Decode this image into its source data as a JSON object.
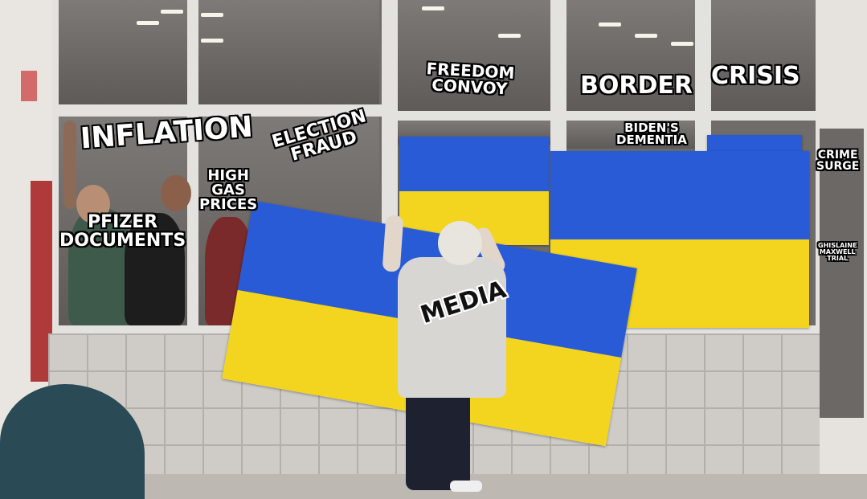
{
  "meme": {
    "labels": {
      "inflation": "INFLATION",
      "election_fraud": "ELECTION\nFRAUD",
      "freedom_convoy": "FREEDOM\nCONVOY",
      "border": "BORDER",
      "crisis": "CRISIS",
      "bidens_dementia": "BIDEN'S\nDEMENTIA",
      "high_gas_prices": "HIGH\nGAS\nPRICES",
      "pfizer_documents": "PFIZER\nDOCUMENTS",
      "crime_surge": "CRIME\nSURGE",
      "ghislaine_maxwell_trial": "GHISLAINE\nMAXWELL\nTRIAL",
      "media": "MEDIA"
    }
  },
  "colors": {
    "flag_blue": "#2a5bd7",
    "flag_yellow": "#f3d520"
  }
}
